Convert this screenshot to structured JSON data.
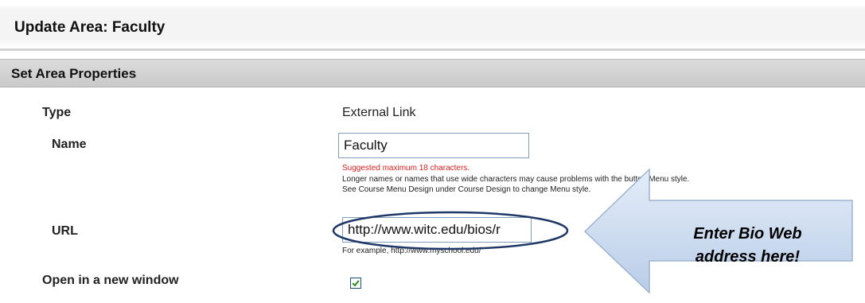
{
  "header": {
    "title": "Update Area: Faculty"
  },
  "section": {
    "title": "Set Area Properties"
  },
  "fields": {
    "type": {
      "label": "Type",
      "value": "External Link"
    },
    "name": {
      "label": "Name",
      "value": "Faculty",
      "warning": "Suggested maximum 18 characters.",
      "help_line1": "Longer names or names that use wide characters may cause problems with the button Menu style.",
      "help_line2": "See Course Menu Design under Course Design to change Menu style."
    },
    "url": {
      "label": "URL",
      "value": "http://www.witc.edu/bios/r",
      "example": "For example, http://www.myschool.edu/"
    },
    "new_window": {
      "label": "Open in a new window",
      "checked": true
    }
  },
  "callout": {
    "line1": "Enter Bio Web",
    "line2": "address here!"
  },
  "colors": {
    "callout_fill": "#c9d9ee",
    "highlight_ring": "#1f3868",
    "check": "#2e8b1a"
  },
  "icons": {
    "checkbox_mark": "check-icon"
  }
}
